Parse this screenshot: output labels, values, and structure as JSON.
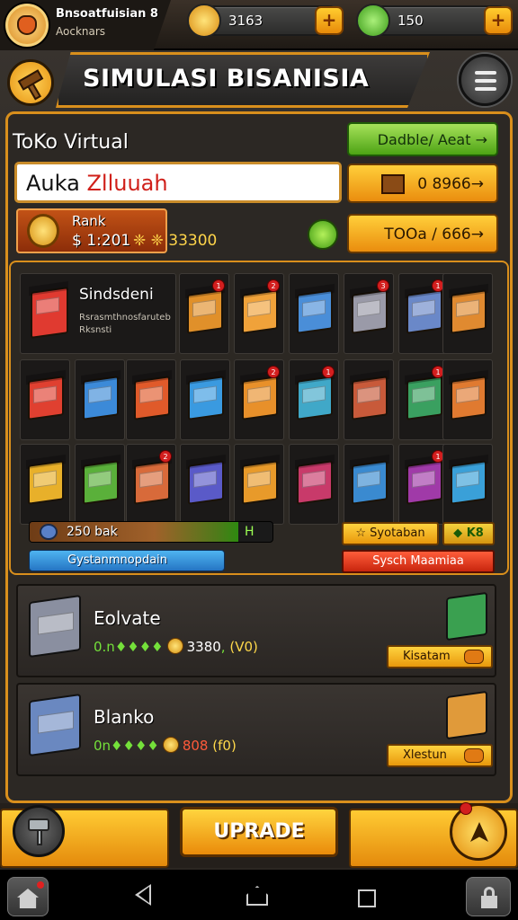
{
  "player": {
    "name": "Bnsoatfuisian 8",
    "subtitle": "Aocknars"
  },
  "resources": {
    "gold": "3163",
    "gems": "150",
    "plus_label": "+"
  },
  "header": {
    "title": "SIMULASI BISANISIA"
  },
  "shop": {
    "name": "ToKo Virtual",
    "search_value_black": "Auka ",
    "search_value_red": "Zlluuah",
    "rank_label": "Rank",
    "rank_value": "$ 1:201",
    "rank_coins": "❈ ❈ 33300",
    "btn_green_label": "Dadble/ Aeat →",
    "btn_price1": "0 8966→",
    "btn_price2": "TOOa / 666→"
  },
  "grid": {
    "featured_title": "Sindsdeni",
    "featured_sub1": "Rsrasmthnosfaruteb",
    "featured_sub2": "Rksnsti",
    "cells_row1": [
      {
        "color": "#e0902a",
        "badge": "1"
      },
      {
        "color": "#f0a23a",
        "badge": "2"
      },
      {
        "color": "#4a8ed8",
        "badge": ""
      },
      {
        "color": "#9a9aa8",
        "badge": "3"
      },
      {
        "color": "#6a88c8",
        "badge": "1"
      },
      {
        "color": "#e08a30",
        "badge": ""
      }
    ],
    "cells_row2": [
      {
        "color": "#e04030",
        "badge": ""
      },
      {
        "color": "#3c8ad8",
        "badge": ""
      },
      {
        "color": "#e05a2a",
        "badge": ""
      },
      {
        "color": "#3a9ae0",
        "badge": ""
      },
      {
        "color": "#e8902a",
        "badge": "2"
      },
      {
        "color": "#40a8c8",
        "badge": "1"
      },
      {
        "color": "#c85a3a",
        "badge": ""
      },
      {
        "color": "#3aa060",
        "badge": "1"
      },
      {
        "color": "#e07a30",
        "badge": ""
      }
    ],
    "cells_row3": [
      {
        "color": "#e8b02a",
        "badge": ""
      },
      {
        "color": "#5ab03a",
        "badge": ""
      },
      {
        "color": "#d86a3a",
        "badge": "2"
      },
      {
        "color": "#5a5ac8",
        "badge": ""
      },
      {
        "color": "#e89a2a",
        "badge": ""
      },
      {
        "color": "#c83a6a",
        "badge": ""
      },
      {
        "color": "#3a8ad0",
        "badge": ""
      },
      {
        "color": "#a03aa8",
        "badge": "1"
      },
      {
        "color": "#3aa0d8",
        "badge": ""
      }
    ],
    "progress_label": "250 bak",
    "progress_end": "H",
    "progress_value": 0.86,
    "progress_sub_label": "Gystanmnopdain",
    "sys_yellow": "☆ Syotaban",
    "sys_green": "◆ K8",
    "sys_red": "Sysch Maamiaa"
  },
  "cards": [
    {
      "title": "Eolvate",
      "rate": "0.n♦♦♦♦",
      "price": "3380",
      "paren": "(V0)",
      "price_red": false,
      "button": "Kisatam",
      "shop_color": "#8a8fa0",
      "shop2_color": "#3aa050"
    },
    {
      "title": "Blanko",
      "rate": "0n♦♦♦♦",
      "price": "808",
      "paren": "(f0)",
      "price_red": true,
      "button": "Xlestun",
      "shop_color": "#6a88c0",
      "shop2_color": "#e09a3a"
    }
  ],
  "bottom": {
    "upgrade_label": "UPRADE"
  },
  "colors": {
    "accent": "#d98f1c",
    "panel": "#2c2824"
  }
}
